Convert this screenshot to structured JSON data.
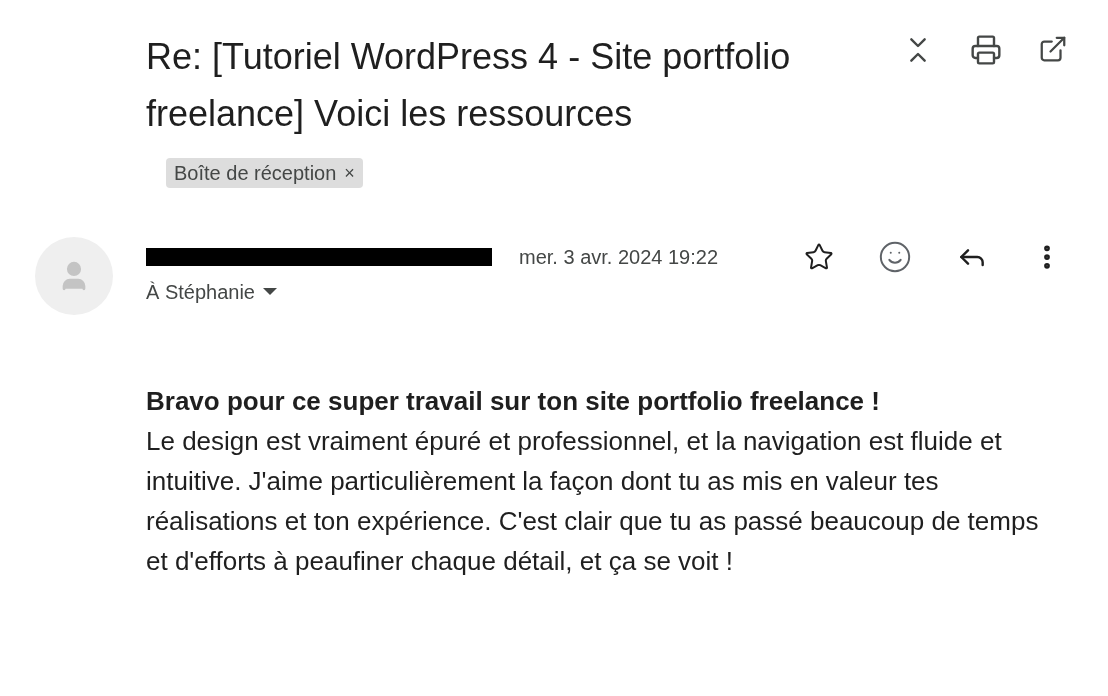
{
  "subject": "Re: [Tutoriel WordPress 4 - Site portfolio freelance] Voici les ressources",
  "label": {
    "text": "Boîte de réception",
    "close": "×"
  },
  "message": {
    "date": "mer. 3 avr. 2024 19:22",
    "starred": false,
    "recipient": "À Stéphanie"
  },
  "body": {
    "lead": "Bravo pour ce super travail sur ton site portfolio freelance !",
    "text": "Le design est vraiment épuré et professionnel, et la navigation est fluide et intuitive. J'aime particulièrement la façon dont tu as mis en valeur tes réalisations et ton expérience. C'est clair que tu as passé beaucoup de temps et d'efforts à peaufiner chaque détail, et ça se voit !"
  }
}
